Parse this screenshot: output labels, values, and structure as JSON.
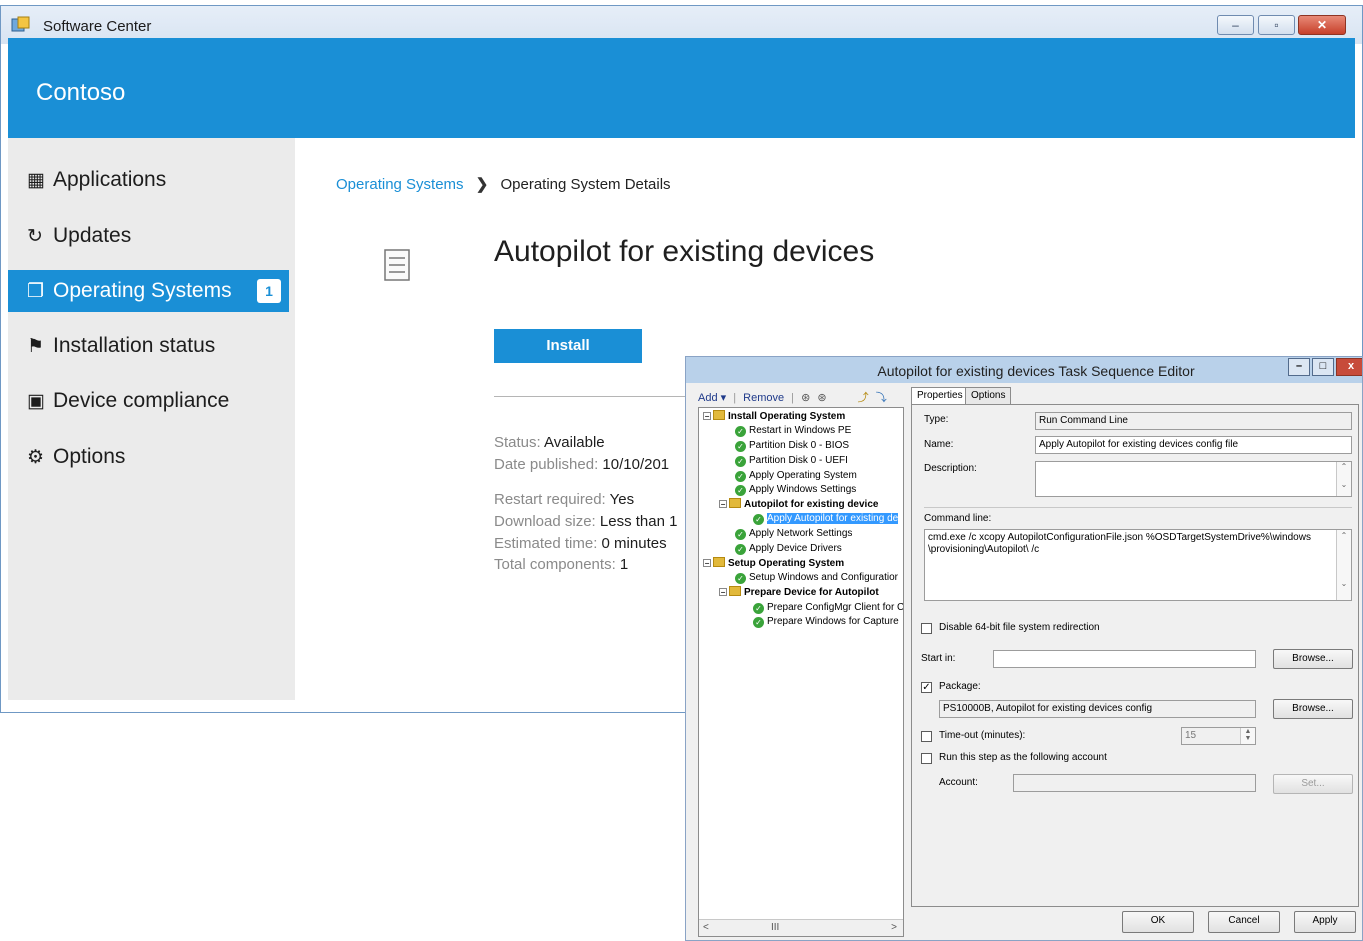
{
  "sc": {
    "window_title": "Software Center",
    "brand": "Contoso",
    "controls": {
      "minimize": "–",
      "maximize": "▫",
      "close": "✕"
    },
    "nav": [
      {
        "label": "Applications",
        "icon": "apps-icon",
        "glyph": "▦"
      },
      {
        "label": "Updates",
        "icon": "refresh-icon",
        "glyph": "↻"
      },
      {
        "label": "Operating Systems",
        "icon": "windows-icon",
        "glyph": "❐",
        "badge": "1",
        "active": true
      },
      {
        "label": "Installation status",
        "icon": "flag-icon",
        "glyph": "⚑"
      },
      {
        "label": "Device compliance",
        "icon": "device-compliance-icon",
        "glyph": "▣"
      },
      {
        "label": "Options",
        "icon": "gear-icon",
        "glyph": "⚙"
      }
    ],
    "breadcrumb": {
      "link": "Operating Systems",
      "separator": "❯",
      "current": "Operating System Details"
    },
    "title": "Autopilot for existing devices",
    "install_label": "Install",
    "details": [
      {
        "label": "Status:",
        "value": "Available"
      },
      {
        "label": "Date published:",
        "value": "10/10/201"
      },
      {
        "label": "Restart required:",
        "value": "Yes"
      },
      {
        "label": "Download size:",
        "value": "Less than 1"
      },
      {
        "label": "Estimated time:",
        "value": "0 minutes"
      },
      {
        "label": "Total components:",
        "value": "1"
      }
    ]
  },
  "ts": {
    "title": "Autopilot for existing devices Task Sequence Editor",
    "toolbar": {
      "add": "Add ▾",
      "sep": "|",
      "remove": "Remove",
      "up": "⊛",
      "down": "⊛",
      "extra1": "⤴",
      "extra2": "⤵"
    },
    "tree": [
      {
        "label": "Install Operating System",
        "type": "group",
        "level": 0
      },
      {
        "label": "Restart in Windows PE",
        "type": "step",
        "level": 1
      },
      {
        "label": "Partition Disk 0 - BIOS",
        "type": "step",
        "level": 1
      },
      {
        "label": "Partition Disk 0 - UEFI",
        "type": "step",
        "level": 1
      },
      {
        "label": "Apply Operating System",
        "type": "step",
        "level": 1
      },
      {
        "label": "Apply Windows Settings",
        "type": "step",
        "level": 1
      },
      {
        "label": "Autopilot for existing device",
        "type": "group",
        "level": 1
      },
      {
        "label": "Apply Autopilot for existing de",
        "type": "step",
        "level": 2,
        "selected": true
      },
      {
        "label": "Apply Network Settings",
        "type": "step",
        "level": 1
      },
      {
        "label": "Apply Device Drivers",
        "type": "step",
        "level": 1
      },
      {
        "label": "Setup Operating System",
        "type": "group",
        "level": 0
      },
      {
        "label": "Setup Windows and Configuratior",
        "type": "step",
        "level": 1
      },
      {
        "label": "Prepare Device for Autopilot",
        "type": "group",
        "level": 1
      },
      {
        "label": "Prepare ConfigMgr Client for C",
        "type": "step",
        "level": 2
      },
      {
        "label": "Prepare Windows for Capture",
        "type": "step",
        "level": 2
      }
    ],
    "hscroll": {
      "left": "<",
      "thumb": "III",
      "right": ">"
    },
    "tabs": {
      "properties": "Properties",
      "options": "Options"
    },
    "props": {
      "type_label": "Type:",
      "type_value": "Run Command Line",
      "name_label": "Name:",
      "name_value": "Apply Autopilot for existing devices config file",
      "description_label": "Description:",
      "description_value": "",
      "cmd_label": "Command line:",
      "cmd_line1": "cmd.exe /c xcopy AutopilotConfigurationFile.json %OSDTargetSystemDrive%\\windows",
      "cmd_line2": "\\provisioning\\Autopilot\\ /c",
      "disable64_label": "Disable 64-bit file system redirection",
      "start_in_label": "Start in:",
      "start_in_value": "",
      "browse": "Browse...",
      "package_label": "Package:",
      "package_checked": "✓",
      "package_value": "PS10000B, Autopilot for existing devices config",
      "timeout_label": "Time-out (minutes):",
      "timeout_value": "15",
      "runas_label": "Run this step as the following account",
      "account_label": "Account:",
      "account_value": "",
      "set": "Set..."
    },
    "buttons": {
      "ok": "OK",
      "cancel": "Cancel",
      "apply": "Apply"
    },
    "controls": {
      "minimize": "–",
      "maximize": "□",
      "close": "x"
    }
  },
  "colors": {
    "accent": "#1a8fd6",
    "sidebar": "#ebebeb",
    "tree_selected": "#3399ff",
    "check_green": "#3aa33a"
  }
}
